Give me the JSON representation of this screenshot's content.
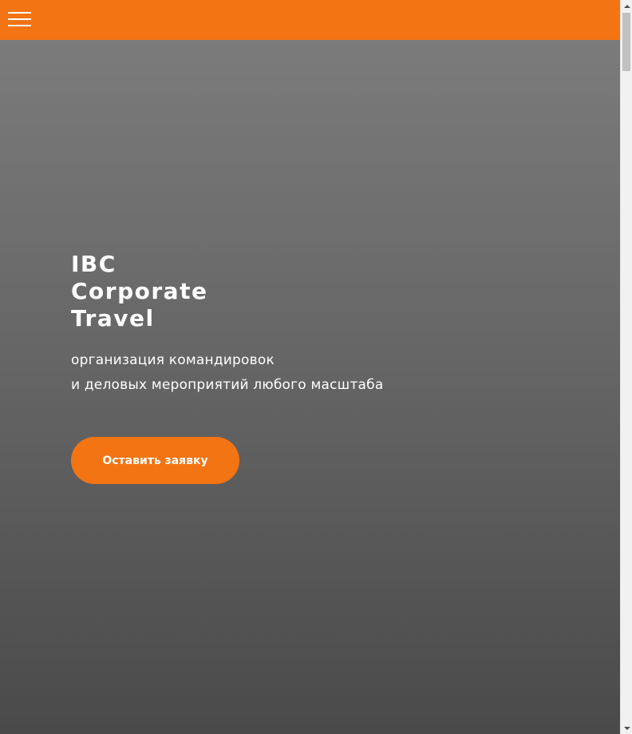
{
  "header": {
    "background_color": "#f37413",
    "menu_icon": "hamburger-menu-icon"
  },
  "hero": {
    "title_lines": [
      "IBC",
      "Corporate",
      "Travel"
    ],
    "subtitle_lines": [
      "организация командировок",
      "и деловых мероприятий любого масштаба"
    ],
    "cta_label": "Оставить заявку",
    "cta_color": "#f37413"
  },
  "scrollbar": {
    "up_icon": "scroll-up-arrow-icon",
    "down_icon": "scroll-down-arrow-icon"
  }
}
